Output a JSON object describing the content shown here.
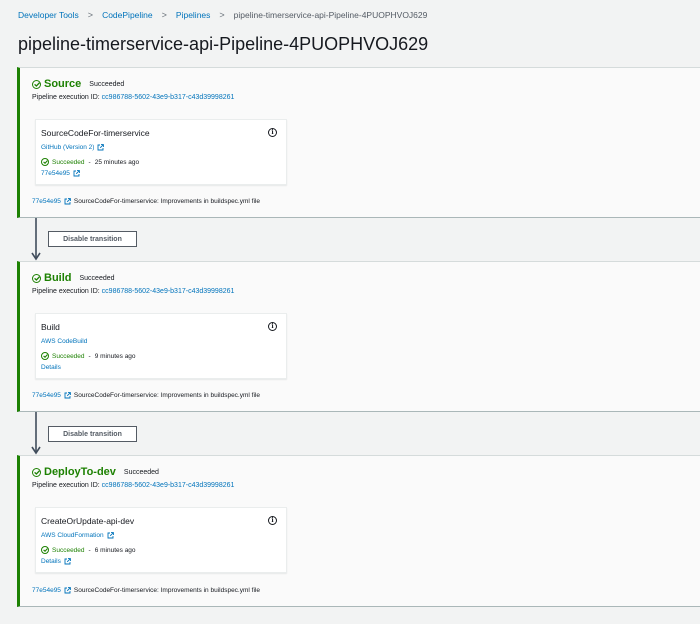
{
  "breadcrumb": {
    "items": [
      "Developer Tools",
      "CodePipeline",
      "Pipelines"
    ],
    "current": "pipeline-timerservice-api-Pipeline-4PUOPHVOJ629",
    "separator": ">"
  },
  "page_title": "pipeline-timerservice-api-Pipeline-4PUOPHVOJ629",
  "transition_button_label": "Disable transition",
  "stages": [
    {
      "name": "Source",
      "status": "Succeeded",
      "exec_label": "Pipeline execution ID:",
      "exec_id": "cc986788-5602-43e9-b317-c43d39998261",
      "action": {
        "name": "SourceCodeFor-timerservice",
        "provider": "GitHub (Version 2)",
        "status": "Succeeded",
        "separator": "-",
        "time_ago": "25 minutes ago",
        "link": "77e54e95"
      },
      "commit_id": "77e54e95",
      "commit_msg": "SourceCodeFor-timerservice: Improvements in buildspec.yml file"
    },
    {
      "name": "Build",
      "status": "Succeeded",
      "exec_label": "Pipeline execution ID:",
      "exec_id": "cc986788-5602-43e9-b317-c43d39998261",
      "action": {
        "name": "Build",
        "provider": "AWS CodeBuild",
        "status": "Succeeded",
        "separator": "-",
        "time_ago": "9 minutes ago",
        "link": "Details"
      },
      "commit_id": "77e54e95",
      "commit_msg": "SourceCodeFor-timerservice: Improvements in buildspec.yml file"
    },
    {
      "name": "DeployTo-dev",
      "status": "Succeeded",
      "exec_label": "Pipeline execution ID:",
      "exec_id": "cc986788-5602-43e9-b317-c43d39998261",
      "action": {
        "name": "CreateOrUpdate-api-dev",
        "provider": "AWS CloudFormation",
        "status": "Succeeded",
        "separator": "-",
        "time_ago": "6 minutes ago",
        "link": "Details"
      },
      "commit_id": "77e54e95",
      "commit_msg": "SourceCodeFor-timerservice: Improvements in buildspec.yml file"
    }
  ],
  "colors": {
    "success": "#1d8102",
    "link": "#0073bb",
    "background": "#f2f3f3"
  },
  "icons": [
    "check-circle-icon",
    "info-icon",
    "external-link-icon",
    "down-arrow-icon"
  ]
}
